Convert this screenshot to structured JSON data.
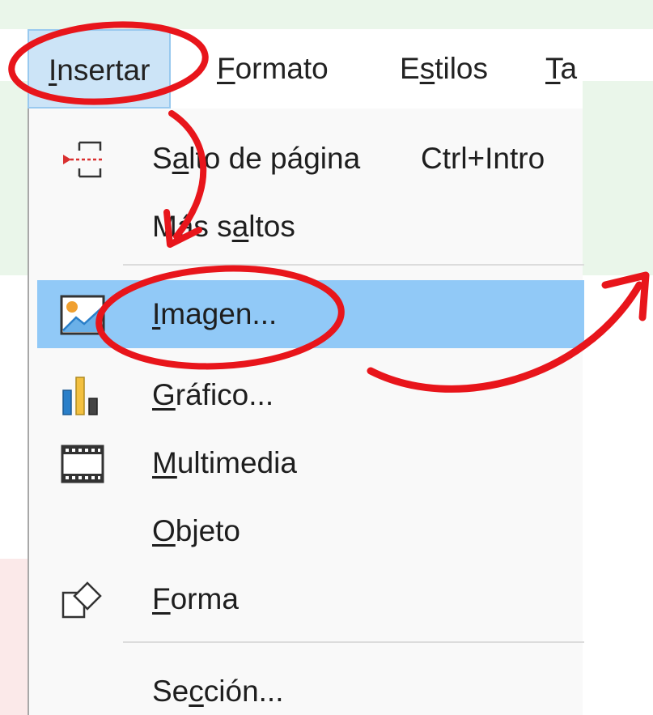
{
  "menubar": {
    "items": [
      {
        "pre": "",
        "acc": "I",
        "post": "nsertar"
      },
      {
        "pre": "",
        "acc": "F",
        "post": "ormato"
      },
      {
        "pre": "E",
        "acc": "s",
        "post": "tilos"
      },
      {
        "pre": "",
        "acc": "T",
        "post": "a"
      }
    ]
  },
  "menu": {
    "items": [
      {
        "pre": "S",
        "acc": "a",
        "post": "lto de página",
        "shortcut": "Ctrl+Intro",
        "icon": "page-break-icon"
      },
      {
        "pre": "Más s",
        "acc": "a",
        "post": "ltos",
        "icon": ""
      },
      {
        "pre": "",
        "acc": "I",
        "post": "magen...",
        "icon": "image-icon",
        "highlighted": true
      },
      {
        "pre": "",
        "acc": "G",
        "post": "ráfico...",
        "icon": "chart-icon"
      },
      {
        "pre": "",
        "acc": "M",
        "post": "ultimedia",
        "icon": "film-icon"
      },
      {
        "pre": "",
        "acc": "O",
        "post": "bjeto",
        "icon": ""
      },
      {
        "pre": "",
        "acc": "F",
        "post": "orma",
        "icon": "shapes-icon"
      },
      {
        "pre": "Se",
        "acc": "c",
        "post": "ción...",
        "icon": ""
      }
    ]
  },
  "colors": {
    "highlight": "#91c9f7",
    "menubar_active": "#cce4f7",
    "annotation_red": "#e8151b"
  }
}
